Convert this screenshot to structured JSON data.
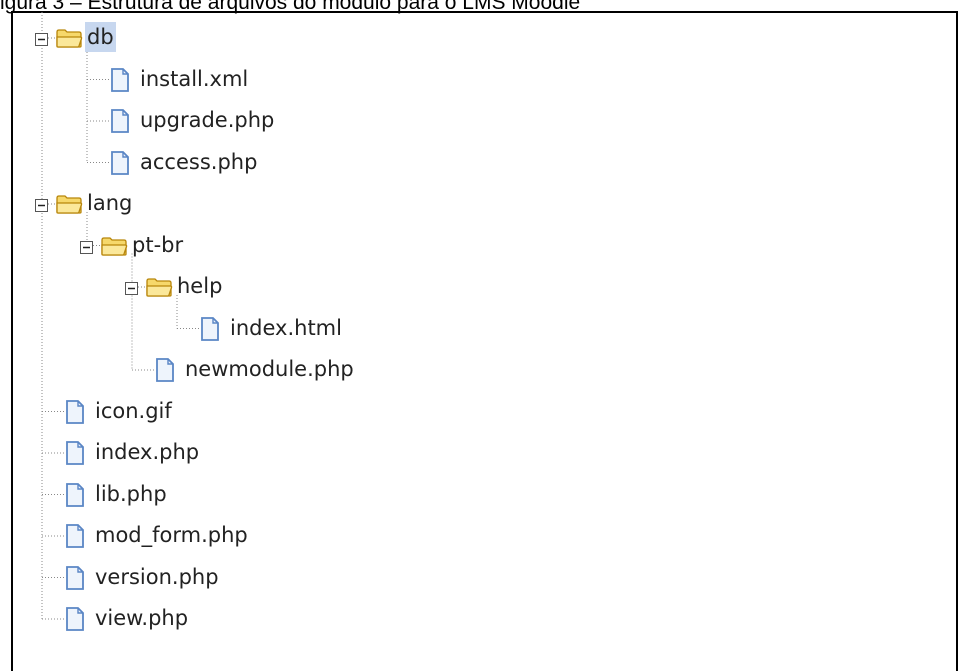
{
  "caption": "igura 3 – Estrutura de arquivos do módulo para o LMS Moodle",
  "tree": [
    {
      "label": "db",
      "type": "folder",
      "depth": 0,
      "expanded": true,
      "selected": true,
      "children": [
        {
          "label": "install.xml",
          "type": "file"
        },
        {
          "label": "upgrade.php",
          "type": "file"
        },
        {
          "label": "access.php",
          "type": "file"
        }
      ]
    },
    {
      "label": "lang",
      "type": "folder",
      "depth": 0,
      "expanded": true,
      "children": [
        {
          "label": "pt-br",
          "type": "folder",
          "expanded": true,
          "children": [
            {
              "label": "help",
              "type": "folder",
              "expanded": true,
              "children": [
                {
                  "label": "index.html",
                  "type": "file"
                }
              ]
            },
            {
              "label": "newmodule.php",
              "type": "file"
            }
          ]
        }
      ]
    },
    {
      "label": "icon.gif",
      "type": "file"
    },
    {
      "label": "index.php",
      "type": "file"
    },
    {
      "label": "lib.php",
      "type": "file"
    },
    {
      "label": "mod_form.php",
      "type": "file"
    },
    {
      "label": "version.php",
      "type": "file"
    },
    {
      "label": "view.php",
      "type": "file"
    }
  ],
  "colors": {
    "folder_fill": "#f6d86b",
    "folder_stroke": "#b8860b",
    "file_stroke": "#5a86c5",
    "file_fill": "#eef4fc",
    "selection": "#c7d7ef",
    "connector": "#888888"
  },
  "icons": {
    "folder": "folder-open-icon",
    "file": "file-icon",
    "toggle": "collapse-toggle-icon"
  }
}
